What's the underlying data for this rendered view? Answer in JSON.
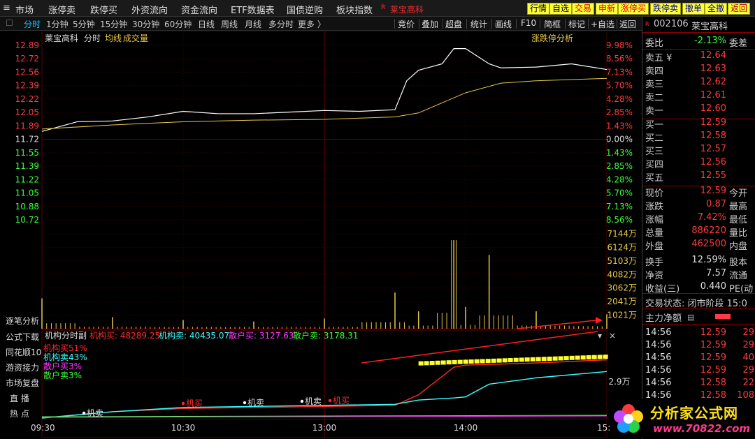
{
  "menu": {
    "items": [
      "市场",
      "涨停卖",
      "跌停买",
      "外资流向",
      "资金流向",
      "ETF数据表",
      "国债逆购",
      "板块指数"
    ],
    "stock_flag": "R",
    "stock": "莱宝高科",
    "right_buttons": [
      "行情",
      "自选",
      "交易",
      "申新",
      "涨停买",
      "跌停卖",
      "撤单",
      "全撤",
      "返回"
    ]
  },
  "tabs": [
    "分时",
    "1分钟",
    "5分钟",
    "15分钟",
    "30分钟",
    "60分钟",
    "日线",
    "周线",
    "月线",
    "多分时",
    "更多 〉"
  ],
  "tools": [
    "竞价",
    "叠加",
    "超盘",
    "统计",
    "画线",
    "F10",
    "简框",
    "标记",
    "+自选",
    "返回"
  ],
  "chart_header": {
    "name": "莱宝高科",
    "period": "分时",
    "ma": "均线",
    "vol": "成交量",
    "analysis": "涨跌停分析"
  },
  "price_ticks": [
    "12.89",
    "12.72",
    "12.56",
    "12.39",
    "12.22",
    "12.05",
    "11.89",
    "11.72",
    "11.55",
    "11.39",
    "11.22",
    "11.05",
    "10.88",
    "10.72"
  ],
  "pct_ticks": [
    "9.98%",
    "8.56%",
    "7.13%",
    "5.70%",
    "4.28%",
    "2.85%",
    "1.43%",
    "0.00%",
    "1.43%",
    "2.85%",
    "4.28%",
    "5.70%",
    "7.13%",
    "8.56%"
  ],
  "vol_ticks": [
    "7144万",
    "6124万",
    "5103万",
    "4082万",
    "3062万",
    "2041万",
    "1021万"
  ],
  "sub_header": {
    "name": "机构分时副",
    "inst_buy_label": "机构买:",
    "inst_buy": "48289.25",
    "inst_sell_label": "机构卖:",
    "inst_sell": "40435.07",
    "retail_buy_label": "散户买:",
    "retail_buy": "3127.63",
    "retail_sell_label": "散户卖:",
    "retail_sell": "3178.31"
  },
  "sub_legend": [
    "机构买51%",
    "机构卖43%",
    "散户买3%",
    "散户卖3%"
  ],
  "sub_scale": "2.9万",
  "sub_marks": [
    "机卖",
    "机买",
    "机卖",
    "机卖",
    "机买"
  ],
  "time_ticks": [
    "09:30",
    "10:30",
    "13:00",
    "14:00",
    "15:00"
  ],
  "left_labels": [
    "逐笔分析",
    "公式下载",
    "同花顺10",
    "游资接力",
    "市场复盘",
    "直  播",
    "热  点"
  ],
  "colors": {
    "price": "#ffffff",
    "avg": "#e8c84a",
    "volume": "#e8c84a",
    "inst_buy": "#ff2a2a",
    "inst_sell": "#3cffff",
    "retail_buy": "#ff3aff",
    "retail_sell": "#3aff3a",
    "trend": "#ff2020",
    "up": "#ff3a3a",
    "down": "#3aff3a",
    "scale_up": "#ff3a3a",
    "scale_down": "#3aff3a"
  },
  "chart_data": [
    {
      "type": "line",
      "series": [
        {
          "name": "价格",
          "x": [
            "09:30",
            "09:45",
            "10:00",
            "10:15",
            "10:30",
            "10:45",
            "11:00",
            "11:15",
            "11:30/13:00",
            "13:15",
            "13:30",
            "13:35",
            "13:40",
            "13:45",
            "13:50",
            "13:55",
            "14:00",
            "14:10",
            "14:15",
            "14:30",
            "14:45",
            "15:00"
          ],
          "values": [
            11.82,
            11.94,
            11.95,
            12.0,
            12.07,
            12.04,
            12.04,
            12.06,
            12.08,
            12.07,
            12.09,
            12.45,
            12.58,
            12.62,
            12.66,
            12.85,
            12.85,
            12.66,
            12.61,
            12.62,
            12.66,
            12.59
          ]
        },
        {
          "name": "均线",
          "x": [
            "09:30",
            "10:00",
            "10:30",
            "11:00",
            "11:30/13:00",
            "13:30",
            "13:40",
            "14:00",
            "14:15",
            "14:30",
            "15:00"
          ],
          "values": [
            11.85,
            11.9,
            11.94,
            11.96,
            11.97,
            12.0,
            12.05,
            12.3,
            12.42,
            12.45,
            12.48
          ]
        }
      ],
      "ylim": [
        10.72,
        12.89
      ]
    },
    {
      "type": "bar",
      "title": "成交量",
      "categories": [
        "09:30",
        "10:00",
        "10:30",
        "11:00",
        "11:30/13:00",
        "13:30",
        "13:40",
        "13:55",
        "14:00",
        "14:10",
        "14:30",
        "15:00"
      ],
      "values": [
        2100,
        800,
        600,
        500,
        700,
        2500,
        1200,
        6124,
        1500,
        5103,
        1200,
        1000
      ],
      "ylim": [
        0,
        7144
      ]
    },
    {
      "type": "line",
      "series": [
        {
          "name": "机构买",
          "x": [
            "09:30",
            "10:00",
            "10:30",
            "11:00",
            "11:30/13:00",
            "13:30",
            "13:40",
            "13:55",
            "14:00",
            "14:30",
            "15:00"
          ],
          "values": [
            0,
            3000,
            4500,
            5000,
            5500,
            6000,
            11000,
            24000,
            25000,
            26000,
            27500
          ]
        },
        {
          "name": "机构卖",
          "x": [
            "09:30",
            "10:00",
            "10:30",
            "11:00",
            "11:30/13:00",
            "13:30",
            "13:40",
            "13:55",
            "14:00",
            "14:10",
            "14:30",
            "15:00"
          ],
          "values": [
            0,
            3000,
            5000,
            5500,
            6000,
            6500,
            8500,
            9500,
            10000,
            16000,
            19000,
            22000
          ]
        }
      ]
    }
  ],
  "right": {
    "code": "002106",
    "name": "莱宝高科",
    "weibi_label": "委比",
    "weibi": "-2.13%",
    "weicha_label": "委差",
    "asks": [
      [
        "卖五 ¥",
        "12.64"
      ],
      [
        "卖四",
        "12.63"
      ],
      [
        "卖三",
        "12.62"
      ],
      [
        "卖二",
        "12.61"
      ],
      [
        "卖一",
        "12.60"
      ]
    ],
    "bids": [
      [
        "买一",
        "12.59"
      ],
      [
        "买二",
        "12.58"
      ],
      [
        "买三",
        "12.57"
      ],
      [
        "买四",
        "12.56"
      ],
      [
        "买五",
        "12.55"
      ]
    ],
    "stats": [
      [
        "现价",
        "12.59",
        "今开"
      ],
      [
        "涨跌",
        "0.87",
        "最高"
      ],
      [
        "涨幅",
        "7.42%",
        "最低"
      ],
      [
        "总量",
        "886220",
        "量比"
      ],
      [
        "外盘",
        "462500",
        "内盘"
      ],
      [
        "换手",
        "12.59%",
        "股本"
      ],
      [
        "净资",
        "7.57",
        "流通"
      ],
      [
        "收益(三)",
        "0.440",
        "PE(动"
      ]
    ],
    "state": "交易状态: 闭市阶段 15:0",
    "net": "主力净额",
    "ticks": [
      [
        "14:56",
        "12.59",
        "29"
      ],
      [
        "14:56",
        "12.59",
        "29"
      ],
      [
        "14:56",
        "12.59",
        "40"
      ],
      [
        "14:56",
        "12.59",
        "29"
      ],
      [
        "14:56",
        "12.58",
        "22"
      ],
      [
        "14:56",
        "12.58",
        "108"
      ]
    ]
  },
  "logo": {
    "text": "分析家公式网",
    "url": "www.70822.com"
  }
}
